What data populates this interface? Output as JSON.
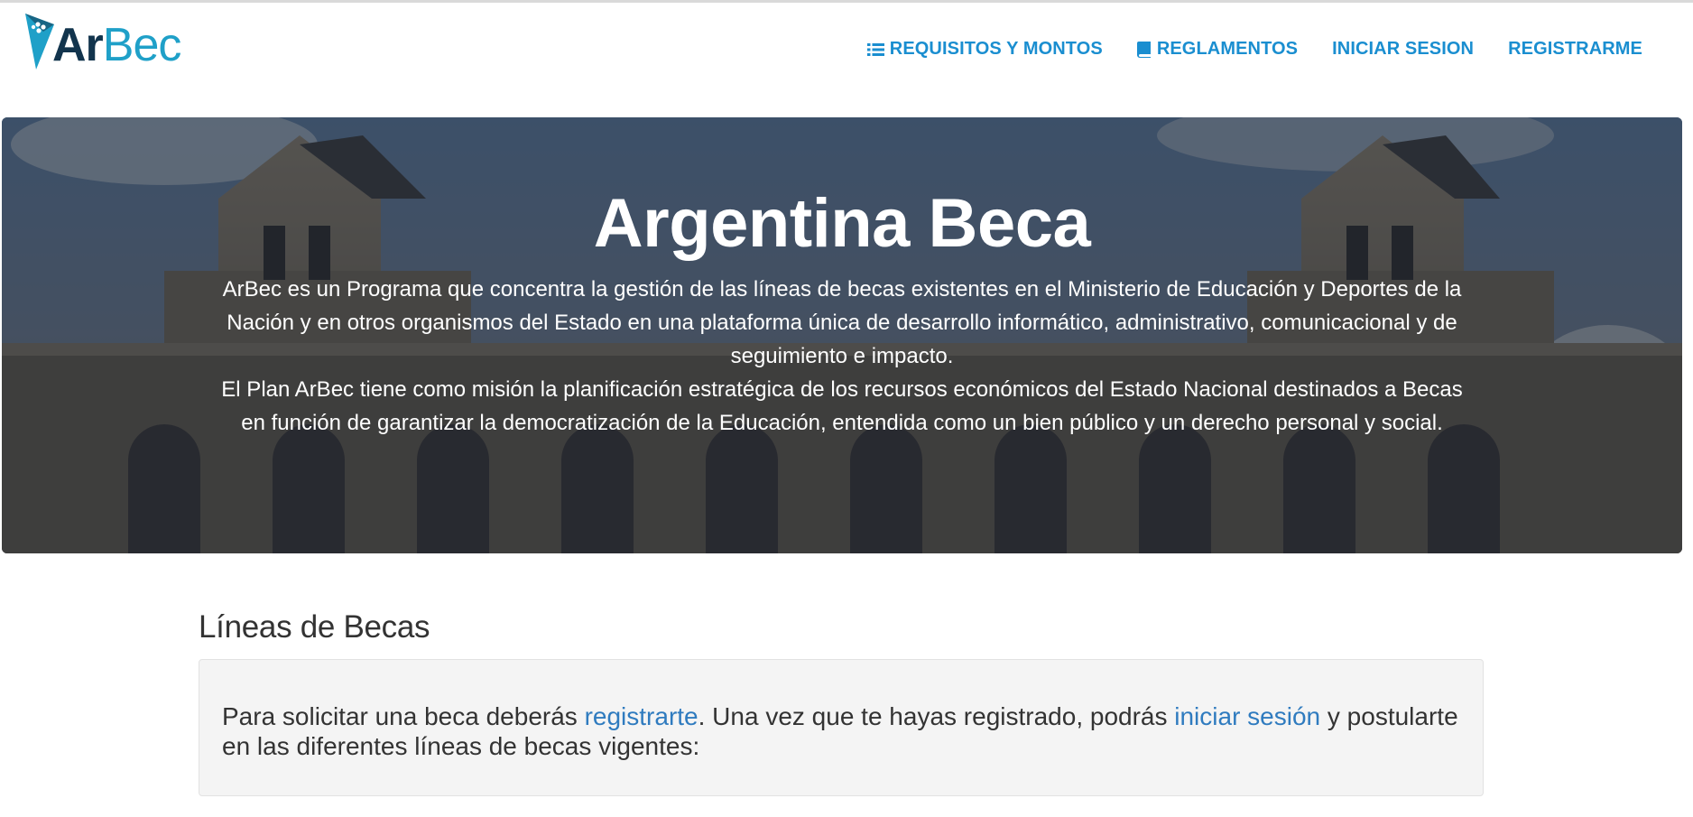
{
  "brand": {
    "ar": "Ar",
    "bec": "Bec",
    "colors": {
      "dark": "#12344d",
      "accent": "#1fa0c8"
    }
  },
  "nav": {
    "items": [
      {
        "label": "REQUISITOS Y MONTOS",
        "icon": "list-icon"
      },
      {
        "label": "REGLAMENTOS",
        "icon": "book-icon"
      },
      {
        "label": "INICIAR SESION"
      },
      {
        "label": "REGISTRARME"
      }
    ],
    "color": "#1a8ed0"
  },
  "hero": {
    "title": "Argentina Beca",
    "paragraph1": "ArBec es un Programa que concentra la gestión de las líneas de becas existentes en el Ministerio de Educación y Deportes de la Nación y en otros organismos del Estado en una plataforma única de desarrollo informático, administrativo, comunicacional y de seguimiento e impacto.",
    "paragraph2": "El Plan ArBec tiene como misión la planificación estratégica de los recursos económicos del Estado Nacional destinados a Becas en función de garantizar la democratización de la Educación, entendida como un bien público y un derecho personal y social."
  },
  "section": {
    "title": "Líneas de Becas",
    "text_before": "Para solicitar una beca deberás ",
    "link_register": "registrarte",
    "text_middle": ". Una vez que te hayas registrado, podrás ",
    "link_login": "iniciar sesión",
    "text_after": " y postularte en las diferentes líneas de becas vigentes:"
  }
}
